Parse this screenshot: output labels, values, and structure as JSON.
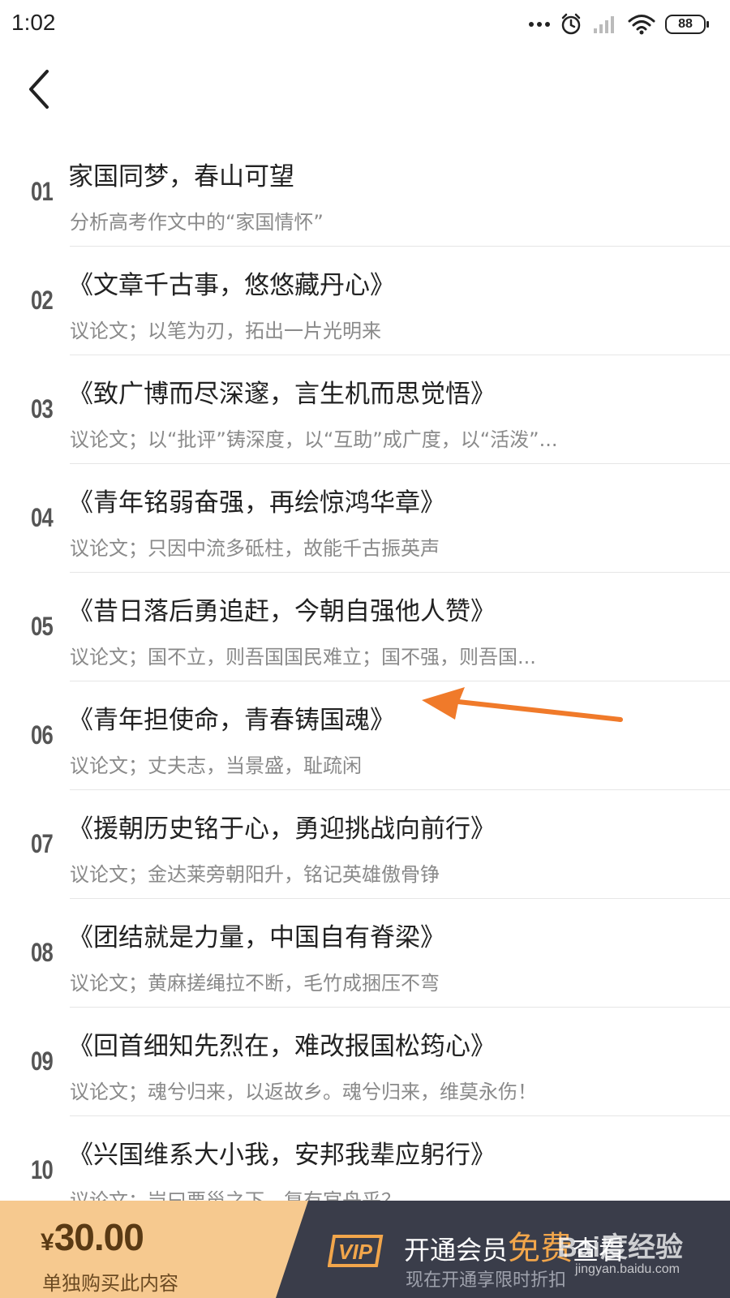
{
  "status_bar": {
    "time": "1:02",
    "battery": "88"
  },
  "items": [
    {
      "number": "01",
      "title": "家国同梦，春山可望",
      "subtitle": "分析高考作文中的“家国情怀”"
    },
    {
      "number": "02",
      "title": "《文章千古事，悠悠藏丹心》",
      "subtitle": "议论文；以笔为刃，拓出一片光明来"
    },
    {
      "number": "03",
      "title": "《致广博而尽深邃，言生机而思觉悟》",
      "subtitle": "议论文；以“批评”铸深度，以“互助”成广度，以“活泼”..."
    },
    {
      "number": "04",
      "title": "《青年铭弱奋强，再绘惊鸿华章》",
      "subtitle": "议论文；只因中流多砥柱，故能千古振英声"
    },
    {
      "number": "05",
      "title": "《昔日落后勇追赶，今朝自强他人赞》",
      "subtitle": "议论文；国不立，则吾国国民难立；国不强，则吾国..."
    },
    {
      "number": "06",
      "title": "《青年担使命，青春铸国魂》",
      "subtitle": "议论文；丈夫志，当景盛，耻疏闲"
    },
    {
      "number": "07",
      "title": "《援朝历史铭于心，勇迎挑战向前行》",
      "subtitle": "议论文；金达莱旁朝阳升，铭记英雄傲骨铮"
    },
    {
      "number": "08",
      "title": "《团结就是力量，中国自有脊梁》",
      "subtitle": "议论文；黄麻搓绳拉不断，毛竹成捆压不弯"
    },
    {
      "number": "09",
      "title": "《回首细知先烈在，难改报国松筠心》",
      "subtitle": "议论文；魂兮归来，以返故乡。魂兮归来，维莫永伤！"
    },
    {
      "number": "10",
      "title": "《兴国维系大小我，安邦我辈应躬行》",
      "subtitle": "议论文；岂曰栗甾之下，复有官舟乎？"
    }
  ],
  "purchase": {
    "currency": "¥",
    "price": "30.00",
    "buy_label": "单独购买此内容"
  },
  "vip": {
    "badge": "VIP",
    "main_prefix": "开通会员",
    "main_free": "免费",
    "main_suffix": "查看",
    "sub": "现在开通享限时折扣"
  },
  "watermark": {
    "main": "Bai度经验",
    "sub": "jingyan.baidu.com"
  },
  "colors": {
    "accent_orange": "#f07a2a",
    "buy_bg": "#f6c98f",
    "vip_bg": "#3a3d4a",
    "free_text": "#f2a64b"
  }
}
